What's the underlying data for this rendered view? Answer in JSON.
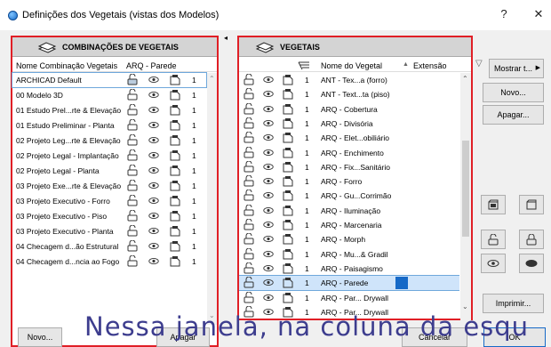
{
  "window": {
    "title": "Definições dos Vegetais (vistas dos Modelos)",
    "help": "?",
    "close": "✕"
  },
  "left": {
    "header": "COMBINAÇÕES DE VEGETAIS",
    "col_name": "Nome Combinação Vegetais",
    "col_layer": "ARQ - Parede",
    "edit_value": "ARCHICAD Default",
    "edit_num": "1",
    "rows": [
      {
        "name": "ARCHICAD Default",
        "num": "1"
      },
      {
        "name": "00 Modelo 3D",
        "num": "1"
      },
      {
        "name": "01 Estudo Prel...rte & Elevação",
        "num": "1"
      },
      {
        "name": "01 Estudo Preliminar - Planta",
        "num": "1"
      },
      {
        "name": "02 Projeto Leg...rte & Elevação",
        "num": "1"
      },
      {
        "name": "02 Projeto Legal - Implantação",
        "num": "1"
      },
      {
        "name": "02 Projeto Legal - Planta",
        "num": "1"
      },
      {
        "name": "03 Projeto Exe...rte & Elevação",
        "num": "1"
      },
      {
        "name": "03 Projeto Executivo - Forro",
        "num": "1"
      },
      {
        "name": "03 Projeto Executivo - Piso",
        "num": "1"
      },
      {
        "name": "03 Projeto Executivo - Planta",
        "num": "1"
      },
      {
        "name": "04 Checagem d...ão Estrutural",
        "num": "1"
      },
      {
        "name": "04 Checagem d...ncia ao Fogo",
        "num": "1"
      }
    ],
    "new_button": "Novo...",
    "delete_button": "Apagar"
  },
  "right": {
    "header": "VEGETAIS",
    "col_name": "Nome do Vegetal",
    "col_ext": "Extensão",
    "sort_marker": "▲",
    "rows": [
      {
        "name": "ANT - Tex...a (forro)",
        "num": "1"
      },
      {
        "name": "ANT - Text...ta (piso)",
        "num": "1"
      },
      {
        "name": "ARQ - Cobertura",
        "num": "1"
      },
      {
        "name": "ARQ - Divisória",
        "num": "1"
      },
      {
        "name": "ARQ - Elet...obiliário",
        "num": "1"
      },
      {
        "name": "ARQ - Enchimento",
        "num": "1"
      },
      {
        "name": "ARQ - Fix...Sanitário",
        "num": "1"
      },
      {
        "name": "ARQ - Forro",
        "num": "1"
      },
      {
        "name": "ARQ - Gu...Corrimão",
        "num": "1"
      },
      {
        "name": "ARQ - Iluminação",
        "num": "1"
      },
      {
        "name": "ARQ - Marcenaria",
        "num": "1"
      },
      {
        "name": "ARQ - Morph",
        "num": "1"
      },
      {
        "name": "ARQ - Mu...& Gradil",
        "num": "1"
      },
      {
        "name": "ARQ - Paisagismo",
        "num": "1"
      },
      {
        "name": "ARQ - Parede",
        "num": "1"
      },
      {
        "name": "ARQ - Par... Drywall",
        "num": "1"
      },
      {
        "name": "ARQ - Par... Drywall",
        "num": "1"
      }
    ]
  },
  "side": {
    "show_filter": "Mostrar t...",
    "new_button": "Novo...",
    "delete_button": "Apagar...",
    "print_button": "Imprimir..."
  },
  "footer": {
    "cancel": "Cancelar",
    "ok": "OK"
  },
  "caption": "Nessa janela, na coluna da esqu",
  "colors": {
    "accent": "#1669c7",
    "frame": "#e01f26",
    "selection": "#cfe4fa"
  }
}
